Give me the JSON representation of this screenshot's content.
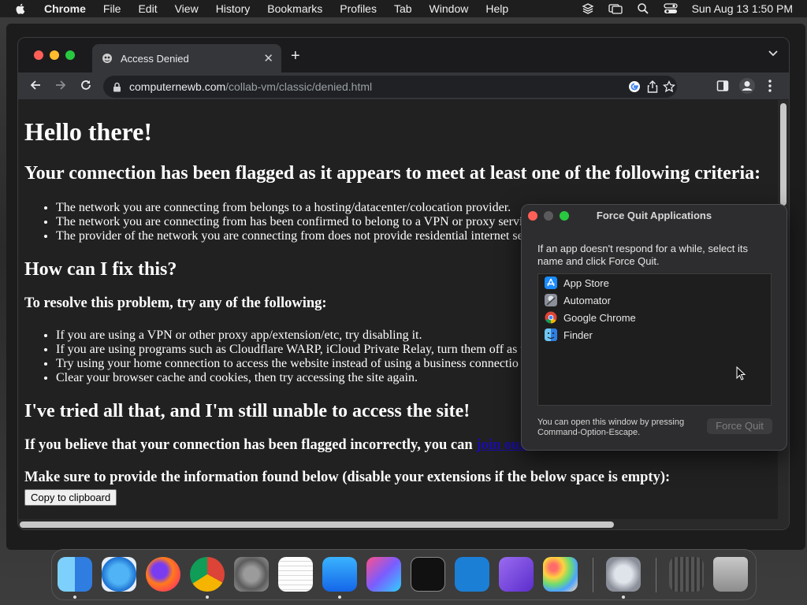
{
  "menubar": {
    "app_name": "Chrome",
    "items": [
      "File",
      "Edit",
      "View",
      "History",
      "Bookmarks",
      "Profiles",
      "Tab",
      "Window",
      "Help"
    ],
    "datetime": "Sun Aug 13  1:50 PM"
  },
  "browser": {
    "tab_title": "Access Denied",
    "url_host": "computernewb.com",
    "url_path": "/collab-vm/classic/denied.html"
  },
  "page": {
    "heading": "Hello there!",
    "flagged_heading": "Your connection has been flagged as it appears to meet at least one of the following criteria:",
    "criteria": [
      "The network you are connecting from belongs to a hosting/datacenter/colocation provider.",
      "The network you are connecting from has been confirmed to belong to a VPN or proxy servi",
      "The provider of the network you are connecting from does not provide residential internet se"
    ],
    "fix_heading": "How can I fix this?",
    "resolve_heading": "To resolve this problem, try any of the following:",
    "fixes": [
      "If you are using a VPN or other proxy app/extension/etc, try disabling it.",
      "If you are using programs such as Cloudflare WARP, iCloud Private Relay, turn them off as t",
      "Try using your home connection to access the website instead of using a business connectio",
      "Clear your browser cache and cookies, then try accessing the site again."
    ],
    "tried_heading": "I've tried all that, and I'm still unable to access the site!",
    "incorrect_text": "If you believe that your connection has been flagged incorrectly, you can",
    "incorrect_link": "join our Discord server",
    "info_text": "Make sure to provide the information found below (disable your extensions if the below space is empty):",
    "copy_button": "Copy to clipboard"
  },
  "force_quit": {
    "title": "Force Quit Applications",
    "description": "If an app doesn't respond for a while, select its name and click Force Quit.",
    "apps": [
      {
        "name": "App Store",
        "icon": "app-store-icon"
      },
      {
        "name": "Automator",
        "icon": "automator-icon"
      },
      {
        "name": "Google Chrome",
        "icon": "chrome-icon"
      },
      {
        "name": "Finder",
        "icon": "finder-icon"
      }
    ],
    "hint": "You can open this window by pressing Command-Option-Escape.",
    "button": "Force Quit"
  },
  "dock": {
    "apps": [
      "finder",
      "safari",
      "firefox",
      "chrome",
      "system-settings",
      "textedit",
      "app-store",
      "shortcuts",
      "terminal",
      "vscode",
      "visual-studio",
      "launchpad",
      "automator",
      "downloads",
      "trash"
    ]
  }
}
